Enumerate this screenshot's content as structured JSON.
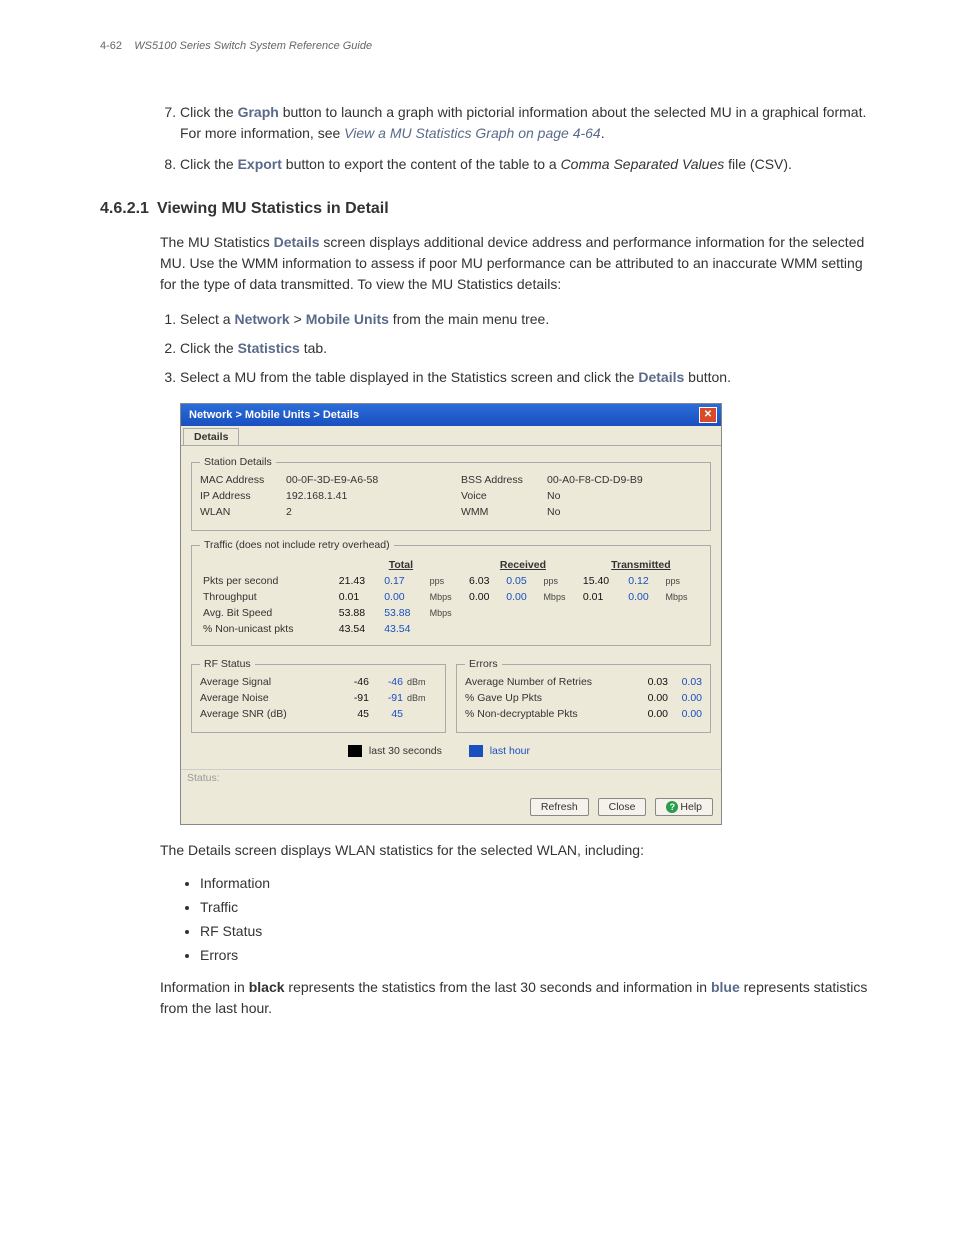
{
  "header": {
    "page_num": "4-62",
    "book_title": "WS5100 Series Switch System Reference Guide"
  },
  "steps_top": [
    {
      "num": "7.",
      "pre": "Click the ",
      "term": "Graph",
      "mid": " button to launch a graph with pictorial information about the selected MU in a graphical format. For more information, see ",
      "link": "View a MU Statistics Graph on page 4-64",
      "post": "."
    },
    {
      "num": "8.",
      "pre": "Click the ",
      "term": "Export",
      "mid": " button to export the content of the table to a ",
      "italic": "Comma Separated Values",
      "post": " file (CSV)."
    }
  ],
  "section": {
    "num": "4.6.2.1",
    "title": "Viewing MU Statistics in Detail"
  },
  "intro": {
    "p1a": "The MU Statistics ",
    "p1term": "Details",
    "p1b": " screen displays additional device address and performance information for the selected MU. Use the WMM information to assess if poor MU performance can be attributed to an inaccurate WMM setting for the type of data transmitted. To view the MU Statistics details:"
  },
  "substeps": [
    {
      "pre": "Select a ",
      "t1": "Network",
      "sep": " > ",
      "t2": "Mobile Units",
      "post": " from the main menu tree."
    },
    {
      "pre": "Click the ",
      "t1": "Statistics",
      "post": " tab."
    },
    {
      "pre": "Select a MU from the table displayed in the Statistics screen and click the ",
      "t1": "Details",
      "post": " button."
    }
  ],
  "window": {
    "titlebar": "Network > Mobile Units > Details",
    "tab": "Details",
    "station": {
      "legend": "Station Details",
      "left": [
        {
          "k": "MAC Address",
          "v": "00-0F-3D-E9-A6-58"
        },
        {
          "k": "IP Address",
          "v": "192.168.1.41"
        },
        {
          "k": "WLAN",
          "v": "2"
        }
      ],
      "right": [
        {
          "k": "BSS Address",
          "v": "00-A0-F8-CD-D9-B9"
        },
        {
          "k": "Voice",
          "v": "No"
        },
        {
          "k": "WMM",
          "v": "No"
        }
      ]
    },
    "traffic": {
      "legend": "Traffic (does not include retry overhead)",
      "headers": [
        "Total",
        "Received",
        "Transmitted"
      ],
      "rows": [
        {
          "label": "Pkts per second",
          "cells": [
            {
              "b": "21.43",
              "h": "0.17",
              "u": "pps"
            },
            {
              "b": "6.03",
              "h": "0.05",
              "u": "pps"
            },
            {
              "b": "15.40",
              "h": "0.12",
              "u": "pps"
            }
          ]
        },
        {
          "label": "Throughput",
          "cells": [
            {
              "b": "0.01",
              "h": "0.00",
              "u": "Mbps"
            },
            {
              "b": "0.00",
              "h": "0.00",
              "u": "Mbps"
            },
            {
              "b": "0.01",
              "h": "0.00",
              "u": "Mbps"
            }
          ]
        },
        {
          "label": "Avg. Bit Speed",
          "cells": [
            {
              "b": "53.88",
              "h": "53.88",
              "u": "Mbps"
            }
          ]
        },
        {
          "label": "% Non-unicast pkts",
          "cells": [
            {
              "b": "43.54",
              "h": "43.54",
              "u": ""
            }
          ]
        }
      ]
    },
    "rf": {
      "legend": "RF Status",
      "rows": [
        {
          "lbl": "Average Signal",
          "b": "-46",
          "h": "-46",
          "u": "dBm"
        },
        {
          "lbl": "Average Noise",
          "b": "-91",
          "h": "-91",
          "u": "dBm"
        },
        {
          "lbl": "Average SNR (dB)",
          "b": "45",
          "h": "45",
          "u": ""
        }
      ]
    },
    "errors": {
      "legend": "Errors",
      "rows": [
        {
          "lbl": "Average Number of Retries",
          "b": "0.03",
          "h": "0.03"
        },
        {
          "lbl": "% Gave Up Pkts",
          "b": "0.00",
          "h": "0.00"
        },
        {
          "lbl": "% Non-decryptable Pkts",
          "b": "0.00",
          "h": "0.00"
        }
      ]
    },
    "legend_row": {
      "l30": "last 30 seconds",
      "lhr": "last hour"
    },
    "status_label": "Status:",
    "buttons": {
      "refresh": "Refresh",
      "close": "Close",
      "help": "Help"
    }
  },
  "after": {
    "p1": "The Details screen displays WLAN statistics for the selected WLAN, including:",
    "bullets": [
      "Information",
      "Traffic",
      "RF Status",
      "Errors"
    ],
    "p2a": "Information in ",
    "p2b": "black",
    "p2c": " represents the statistics from the last 30 seconds and information in ",
    "p2d": "blue",
    "p2e": " represents statistics from the last hour."
  }
}
